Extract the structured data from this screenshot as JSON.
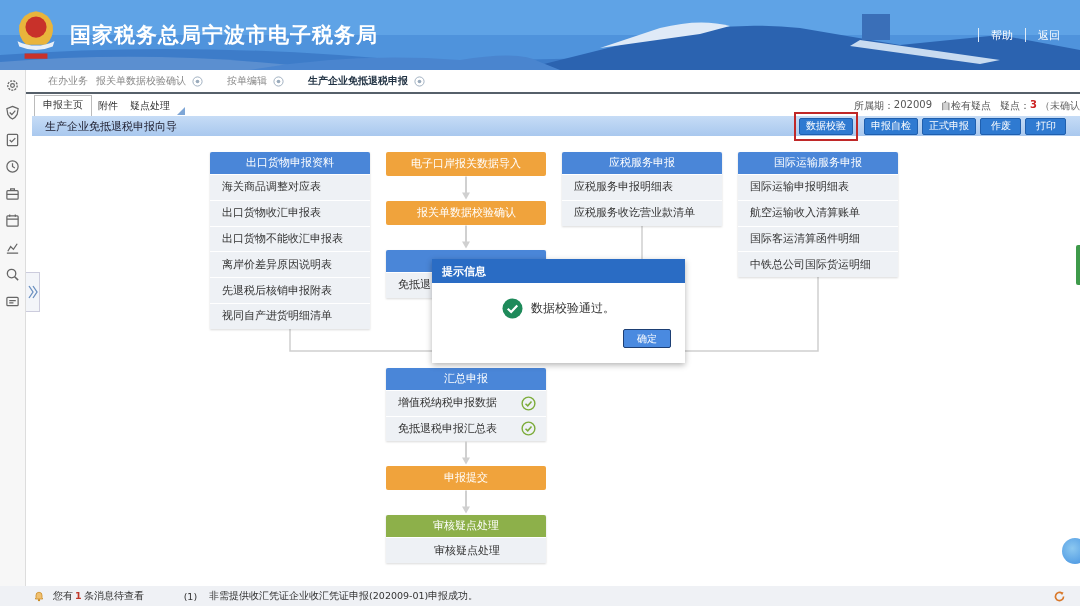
{
  "header": {
    "title": "国家税务总局宁波市电子税务局",
    "links": [
      "帮助",
      "返回"
    ]
  },
  "tabs": [
    {
      "label": "在办业务",
      "selected": false,
      "closable": false
    },
    {
      "label": "报关单数据校验确认",
      "selected": false,
      "closable": true
    },
    {
      "label": "按单编辑",
      "selected": false,
      "closable": true
    },
    {
      "label": "生产企业免抵退税申报",
      "selected": true,
      "closable": true
    }
  ],
  "subtabs": [
    {
      "label": "申报主页",
      "selected": true
    },
    {
      "label": "附件",
      "selected": false
    },
    {
      "label": "疑点处理",
      "selected": false
    }
  ],
  "period_info": {
    "period_label": "所属期：",
    "period": "202009",
    "flag": "自检有疑点",
    "doubt_label": "疑点：",
    "doubt_count": "3",
    "note": "（未确认"
  },
  "wizard": {
    "title": "生产企业免抵退税申报向导",
    "buttons": [
      {
        "label": "数据校验",
        "highlighted": true
      },
      {
        "label": "申报自检",
        "highlighted": false
      },
      {
        "label": "正式申报",
        "highlighted": false
      },
      {
        "label": "作废",
        "highlighted": false
      },
      {
        "label": "打印",
        "highlighted": false
      }
    ]
  },
  "flow": {
    "left": {
      "header": "出口货物申报资料",
      "items": [
        {
          "label": "海关商品调整对应表"
        },
        {
          "label": "出口货物收汇申报表"
        },
        {
          "label": "出口货物不能收汇申报表"
        },
        {
          "label": "离岸价差异原因说明表"
        },
        {
          "label": "先退税后核销申报附表"
        },
        {
          "label": "视同自产进货明细清单"
        }
      ]
    },
    "center": [
      {
        "kind": "action",
        "label": "电子口岸报关数据导入"
      },
      {
        "kind": "action",
        "label": "报关单数据校验确认"
      },
      {
        "kind": "group",
        "items": [
          {
            "label": "免抵退"
          }
        ]
      },
      {
        "kind": "group",
        "header": "汇总申报",
        "items": [
          {
            "label": "增值税纳税申报数据",
            "checked": true
          },
          {
            "label": "免抵退税申报汇总表",
            "checked": true
          }
        ]
      },
      {
        "kind": "action",
        "label": "申报提交"
      },
      {
        "kind": "review",
        "header": "审核疑点处理",
        "items": [
          {
            "label": "审核疑点处理"
          }
        ]
      }
    ],
    "right": [
      {
        "header": "应税服务申报",
        "items": [
          {
            "label": "应税服务申报明细表"
          },
          {
            "label": "应税服务收讫营业款清单"
          }
        ]
      },
      {
        "header": "国际运输服务申报",
        "items": [
          {
            "label": "国际运输申报明细表"
          },
          {
            "label": "航空运输收入清算账单"
          },
          {
            "label": "国际客运清算函件明细"
          },
          {
            "label": "中铁总公司国际货运明细"
          }
        ]
      }
    ]
  },
  "dialog": {
    "title": "提示信息",
    "message": "数据校验通过。",
    "button": "确定"
  },
  "status_bar": {
    "notice": "您有**1**条消息待查看",
    "index": "(1)",
    "message": "非需提供收汇凭证企业收汇凭证申报(202009-01)申报成功。"
  }
}
